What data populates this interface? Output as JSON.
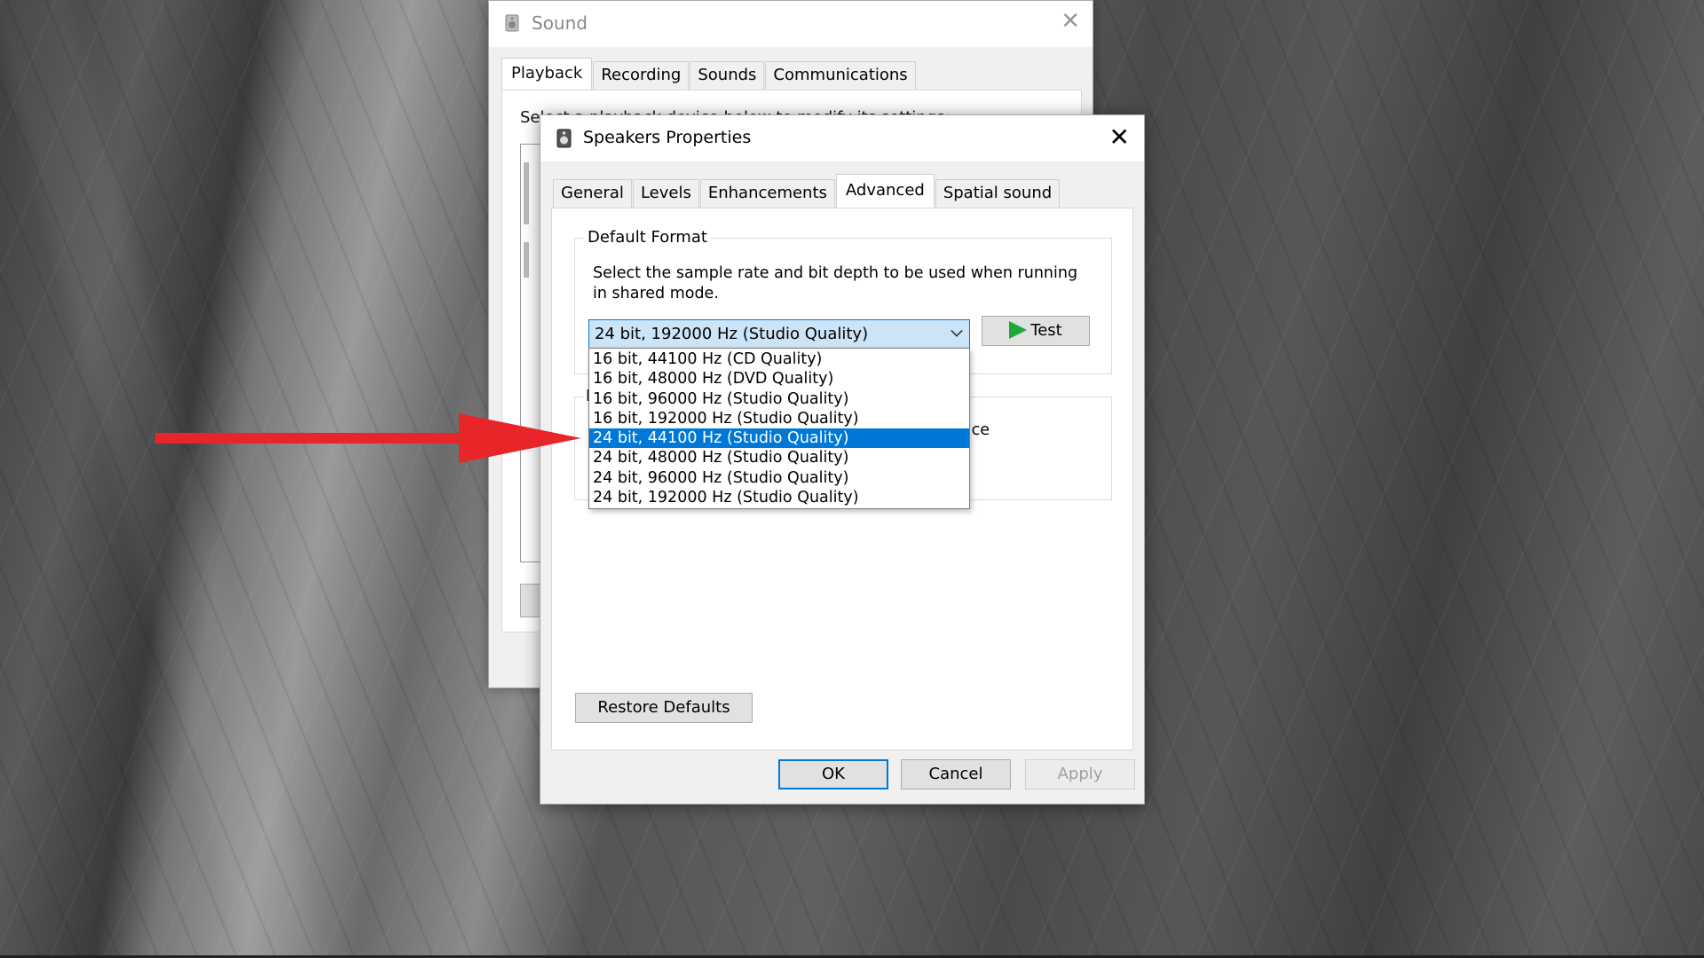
{
  "sound_window": {
    "title": "Sound",
    "tabs": [
      "Playback",
      "Recording",
      "Sounds",
      "Communications"
    ],
    "active_tab": "Playback",
    "instruction_partial": "Select a playback device below to modify its settings:"
  },
  "properties_dialog": {
    "title": "Speakers Properties",
    "tabs": [
      "General",
      "Levels",
      "Enhancements",
      "Advanced",
      "Spatial sound"
    ],
    "active_tab": "Advanced",
    "default_format": {
      "legend": "Default Format",
      "description": "Select the sample rate and bit depth to be used when running in shared mode.",
      "selected_value": "24 bit, 192000 Hz (Studio Quality)",
      "test_label": "Test",
      "options": [
        "16 bit, 44100 Hz (CD Quality)",
        "16 bit, 48000 Hz (DVD Quality)",
        "16 bit, 96000 Hz (Studio Quality)",
        "16 bit, 192000 Hz (Studio Quality)",
        "24 bit, 44100 Hz (Studio Quality)",
        "24 bit, 48000 Hz (Studio Quality)",
        "24 bit, 96000 Hz (Studio Quality)",
        "24 bit, 192000 Hz (Studio Quality)"
      ],
      "highlighted_option": "24 bit, 44100 Hz (Studio Quality)"
    },
    "exclusive_mode": {
      "legend_partial": "E",
      "text_partial": "this device"
    },
    "restore_defaults_label": "Restore Defaults",
    "ok_label": "OK",
    "cancel_label": "Cancel",
    "apply_label": "Apply"
  },
  "colors": {
    "accent": "#0078d7",
    "annotation_arrow": "#e8262a",
    "play_icon": "#1fa83a"
  }
}
